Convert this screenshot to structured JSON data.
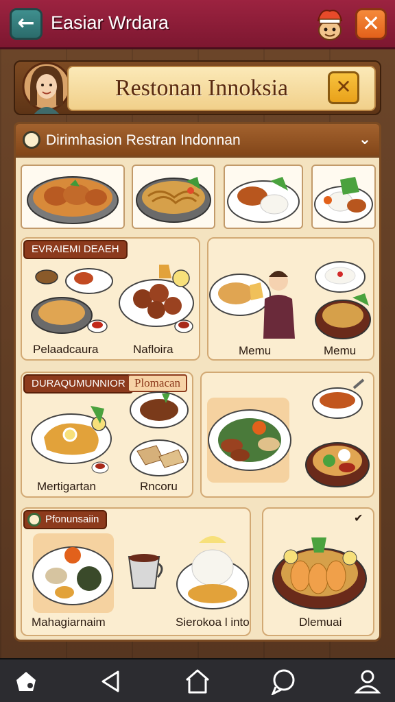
{
  "header": {
    "back_icon": "arrow-left-icon",
    "title": "Easiar Wrdara",
    "close_icon": "close-icon"
  },
  "banner": {
    "title": "Restonan Innoksia",
    "close_icon": "close-x-icon"
  },
  "section": {
    "title": "Dirimhasion Restran Indonnan",
    "chevron_icon": "chevron-down-icon"
  },
  "groups": [
    {
      "tag": "EVRAIEMI DEAEH",
      "items": [
        {
          "label": "Pelaadcaura"
        },
        {
          "label": "Nafloira"
        }
      ]
    },
    {
      "tag": "",
      "items": [
        {
          "label": "Memu"
        },
        {
          "label": "Memu"
        }
      ]
    },
    {
      "tag": "DURAQUMUNNIOR",
      "tag2": "Plomacan",
      "items": [
        {
          "label": "Mertigartan"
        },
        {
          "label": "Rncoru"
        }
      ]
    },
    {
      "tag": "Pfonunsaiin",
      "items": [
        {
          "label": "Mahagiarnaim"
        },
        {
          "label": "Sierokoa l into"
        }
      ]
    },
    {
      "tag": "",
      "chevron": "✔",
      "items": [
        {
          "label": "Dlemuai"
        }
      ]
    }
  ],
  "nav": {
    "items": [
      "home-shape-icon",
      "back-triangle-icon",
      "house-icon",
      "chat-icon",
      "profile-icon"
    ]
  },
  "colors": {
    "topbar": "#9c2340",
    "panel": "#f4e3c0",
    "section_head": "#a3622e",
    "accent_orange": "#e2611b",
    "banner_gold": "#f1d08a"
  }
}
